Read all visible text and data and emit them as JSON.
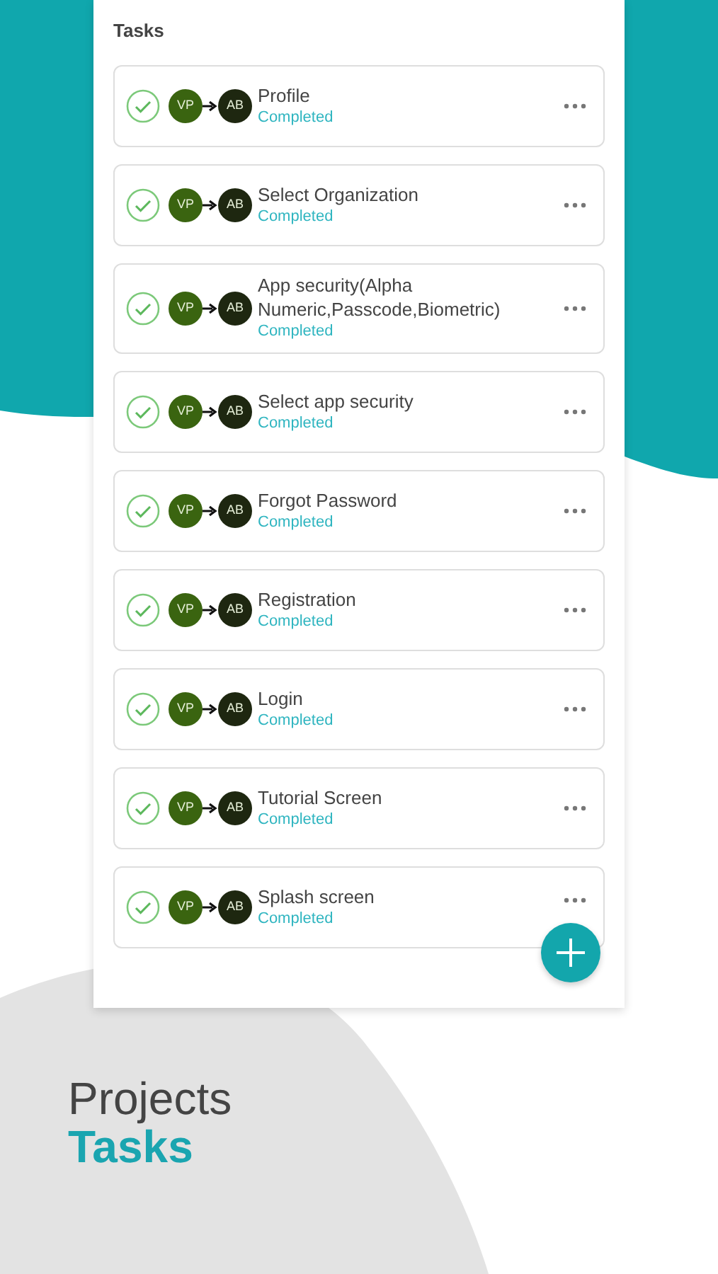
{
  "card": {
    "title": "Tasks"
  },
  "tasks": [
    {
      "title": "Profile",
      "status": "Completed",
      "from": "VP",
      "to": "AB",
      "completed": true
    },
    {
      "title": "Select Organization",
      "status": "Completed",
      "from": "VP",
      "to": "AB",
      "completed": true
    },
    {
      "title": "App security(Alpha Numeric,Passcode,Biometric)",
      "status": "Completed",
      "from": "VP",
      "to": "AB",
      "completed": true
    },
    {
      "title": "Select app security",
      "status": "Completed",
      "from": "VP",
      "to": "AB",
      "completed": true
    },
    {
      "title": "Forgot Password",
      "status": "Completed",
      "from": "VP",
      "to": "AB",
      "completed": true
    },
    {
      "title": "Registration",
      "status": "Completed",
      "from": "VP",
      "to": "AB",
      "completed": true
    },
    {
      "title": "Login",
      "status": "Completed",
      "from": "VP",
      "to": "AB",
      "completed": true
    },
    {
      "title": "Tutorial Screen",
      "status": "Completed",
      "from": "VP",
      "to": "AB",
      "completed": true
    },
    {
      "title": "Splash screen",
      "status": "Completed",
      "from": "VP",
      "to": "AB",
      "completed": true
    }
  ],
  "caption": {
    "line_1": "Projects",
    "line_2": "Tasks"
  }
}
